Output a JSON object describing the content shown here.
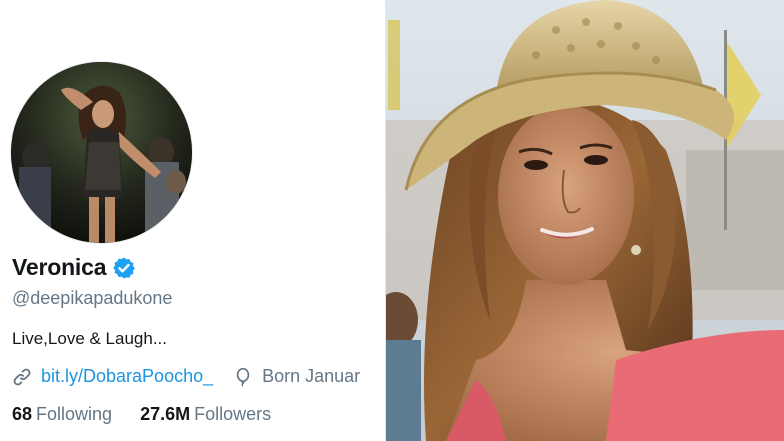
{
  "profile": {
    "display_name": "Veronica",
    "handle": "@deepikapadukone",
    "bio": "Live,Love & Laugh...",
    "website": "bit.ly/DobaraPoocho_",
    "birth": "Born Januar",
    "verified": true,
    "icons": {
      "verified": "verified-badge-icon",
      "link": "link-icon",
      "birthday": "balloon-icon"
    },
    "stats": {
      "following_count": "68",
      "following_label": "Following",
      "followers_count": "27.6M",
      "followers_label": "Followers"
    }
  },
  "colors": {
    "accent": "#1b95e0",
    "text_primary": "#14171a",
    "text_secondary": "#657786"
  }
}
